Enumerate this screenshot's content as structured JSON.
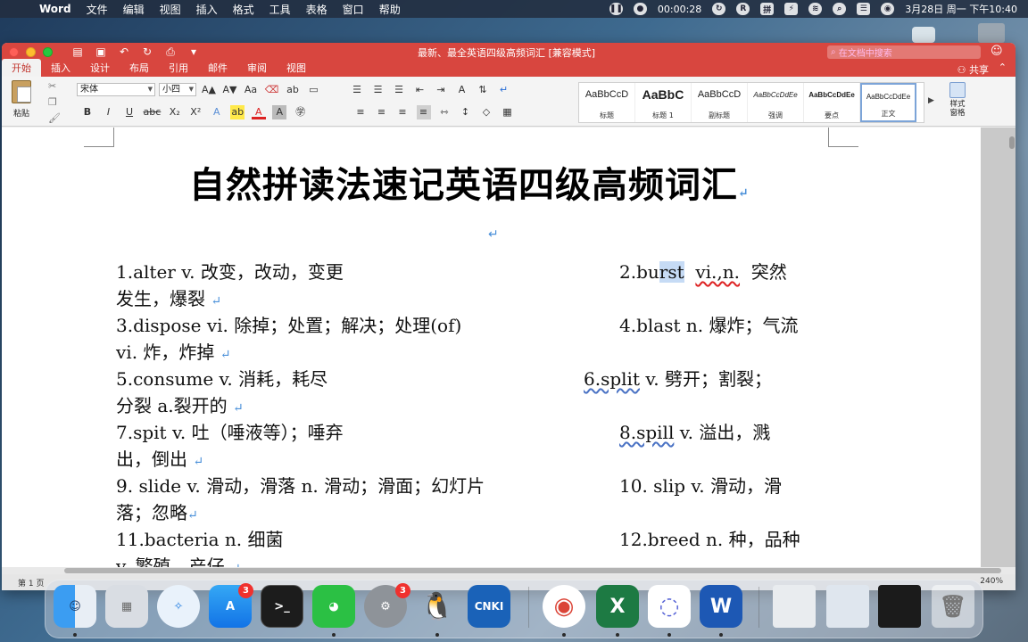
{
  "menubar": {
    "app_name": "Word",
    "items": [
      "文件",
      "编辑",
      "视图",
      "插入",
      "格式",
      "工具",
      "表格",
      "窗口",
      "帮助"
    ],
    "timer": "00:00:28",
    "clock": "3月28日 周一 下午10:40"
  },
  "window": {
    "title": "最新、最全英语四级高频词汇 [兼容模式]",
    "search_placeholder": "在文档中搜索",
    "tabs": [
      "开始",
      "插入",
      "设计",
      "布局",
      "引用",
      "邮件",
      "审阅",
      "视图"
    ],
    "active_tab": "开始",
    "share_label": "共享"
  },
  "ribbon": {
    "paste_label": "粘贴",
    "font_name": "宋体",
    "font_size": "小四",
    "styles": [
      {
        "sample": "AaBbCcD",
        "name": "标题"
      },
      {
        "sample": "AaBbC",
        "name": "标题 1"
      },
      {
        "sample": "AaBbCcD",
        "name": "副标题"
      },
      {
        "sample": "AaBbCcDdEe",
        "name": "强调"
      },
      {
        "sample": "AaBbCcDdEe",
        "name": "要点"
      },
      {
        "sample": "AaBbCcDdEe",
        "name": "正文"
      }
    ],
    "active_style": "正文",
    "styles_pane_label_1": "样式",
    "styles_pane_label_2": "窗格"
  },
  "document": {
    "heading": "自然拼读法速记英语四级高频词汇",
    "lines": [
      {
        "left": "1.alter v. 改变，改动，变更",
        "right_pre": "2.bu",
        "right_hl": "rst",
        "right_squig": "vi.,n.",
        "right_post": "突然"
      },
      {
        "left": "发生，爆裂"
      },
      {
        "left": "3.dispose vi. 除掉；处置；解决；处理(of)",
        "right": "4.blast n. 爆炸；气流"
      },
      {
        "left": "vi. 炸，炸掉"
      },
      {
        "left": "5.consume v. 消耗，耗尽",
        "right_link": "6.split",
        "right": " v. 劈开；割裂；"
      },
      {
        "left": "分裂 a.裂开的"
      },
      {
        "left": "7.spit v. 吐（唾液等）；唾弃",
        "right_link": "8.spill",
        "right": " v. 溢出，溅"
      },
      {
        "left": "出，倒出"
      },
      {
        "left": "9. slide v. 滑动，滑落 n. 滑动；滑面；幻灯片",
        "right": "10. slip v. 滑动，滑"
      },
      {
        "left": "落；忽略"
      },
      {
        "left": "11.bacteria n. 细菌",
        "right": "12.breed n. 种，品种"
      },
      {
        "left": "v. 繁殖，产仔"
      }
    ]
  },
  "statusbar": {
    "page": "第 1 页",
    "zoom": "240%"
  },
  "dock": {
    "apps": [
      {
        "name": "Finder",
        "badge": ""
      },
      {
        "name": "Launchpad",
        "badge": ""
      },
      {
        "name": "Safari",
        "badge": ""
      },
      {
        "name": "App Store",
        "badge": "3"
      },
      {
        "name": "Terminal",
        "badge": ""
      },
      {
        "name": "WeChat",
        "badge": ""
      },
      {
        "name": "System Preferences",
        "badge": "3"
      },
      {
        "name": "QQ",
        "badge": ""
      },
      {
        "name": "CNKI",
        "badge": ""
      },
      {
        "name": "Chrome",
        "badge": ""
      },
      {
        "name": "Excel",
        "badge": ""
      },
      {
        "name": "Cubox",
        "badge": ""
      },
      {
        "name": "Word",
        "badge": ""
      }
    ],
    "cnki_label": "CNKI",
    "excel_label": "X",
    "word_label": "W"
  }
}
